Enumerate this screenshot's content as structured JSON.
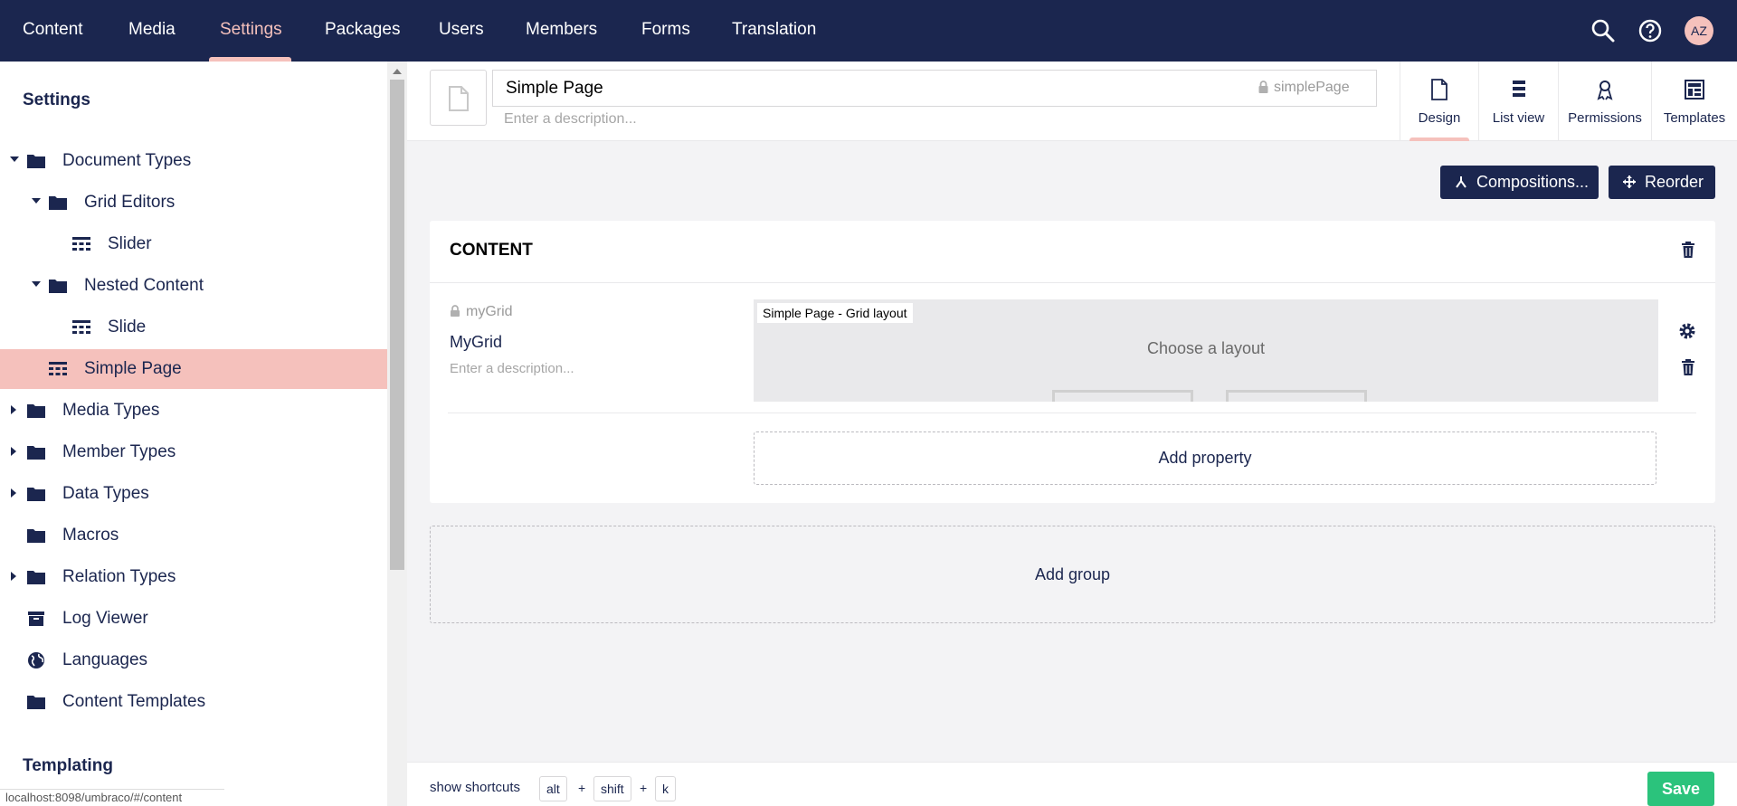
{
  "topnav": {
    "items": [
      {
        "label": "Content"
      },
      {
        "label": "Media"
      },
      {
        "label": "Settings"
      },
      {
        "label": "Packages"
      },
      {
        "label": "Users"
      },
      {
        "label": "Members"
      },
      {
        "label": "Forms"
      },
      {
        "label": "Translation"
      }
    ],
    "active_item": "Settings",
    "avatar_initials": "AZ",
    "icons": [
      "search-icon",
      "help-icon"
    ]
  },
  "sidebar": {
    "title": "Settings",
    "tree": [
      {
        "label": "Document Types",
        "icon": "folder-icon",
        "expanded": true
      },
      {
        "label": "Grid Editors",
        "icon": "folder-icon",
        "expanded": true
      },
      {
        "label": "Slider",
        "icon": "grid-icon"
      },
      {
        "label": "Nested Content",
        "icon": "folder-icon",
        "expanded": true
      },
      {
        "label": "Slide",
        "icon": "grid-icon"
      },
      {
        "label": "Simple Page",
        "icon": "grid-icon",
        "selected": true
      },
      {
        "label": "Media Types",
        "icon": "folder-icon",
        "expanded": false
      },
      {
        "label": "Member Types",
        "icon": "folder-icon",
        "expanded": false
      },
      {
        "label": "Data Types",
        "icon": "folder-icon",
        "expanded": false
      },
      {
        "label": "Macros",
        "icon": "folder-icon"
      },
      {
        "label": "Relation Types",
        "icon": "folder-icon",
        "expanded": false
      },
      {
        "label": "Log Viewer",
        "icon": "box-icon"
      },
      {
        "label": "Languages",
        "icon": "globe-icon"
      },
      {
        "label": "Content Templates",
        "icon": "folder-icon"
      }
    ],
    "templating_title": "Templating",
    "status_url": "localhost:8098/umbraco/#/content"
  },
  "editor": {
    "name_value": "Simple Page",
    "alias": "simplePage",
    "description_placeholder": "Enter a description...",
    "apps": [
      {
        "label": "Design",
        "icon": "document-icon",
        "active": true
      },
      {
        "label": "List view",
        "icon": "list-icon"
      },
      {
        "label": "Permissions",
        "icon": "permissions-icon"
      },
      {
        "label": "Templates",
        "icon": "template-icon"
      }
    ],
    "compositions_label": "Compositions...",
    "reorder_label": "Reorder",
    "group": {
      "title": "CONTENT",
      "property": {
        "alias": "myGrid",
        "name": "MyGrid",
        "description_placeholder": "Enter a description...",
        "preview_label": "Simple Page - Grid layout",
        "preview_text": "Choose a layout"
      },
      "add_property_label": "Add property"
    },
    "add_group_label": "Add group"
  },
  "footer": {
    "shortcuts_label": "show shortcuts",
    "keys": [
      "alt",
      "shift",
      "k"
    ],
    "plus": "+",
    "save_label": "Save"
  },
  "colors": {
    "nav_bg": "#1b264f",
    "accent": "#f5c1bc",
    "save": "#2bc37c"
  }
}
